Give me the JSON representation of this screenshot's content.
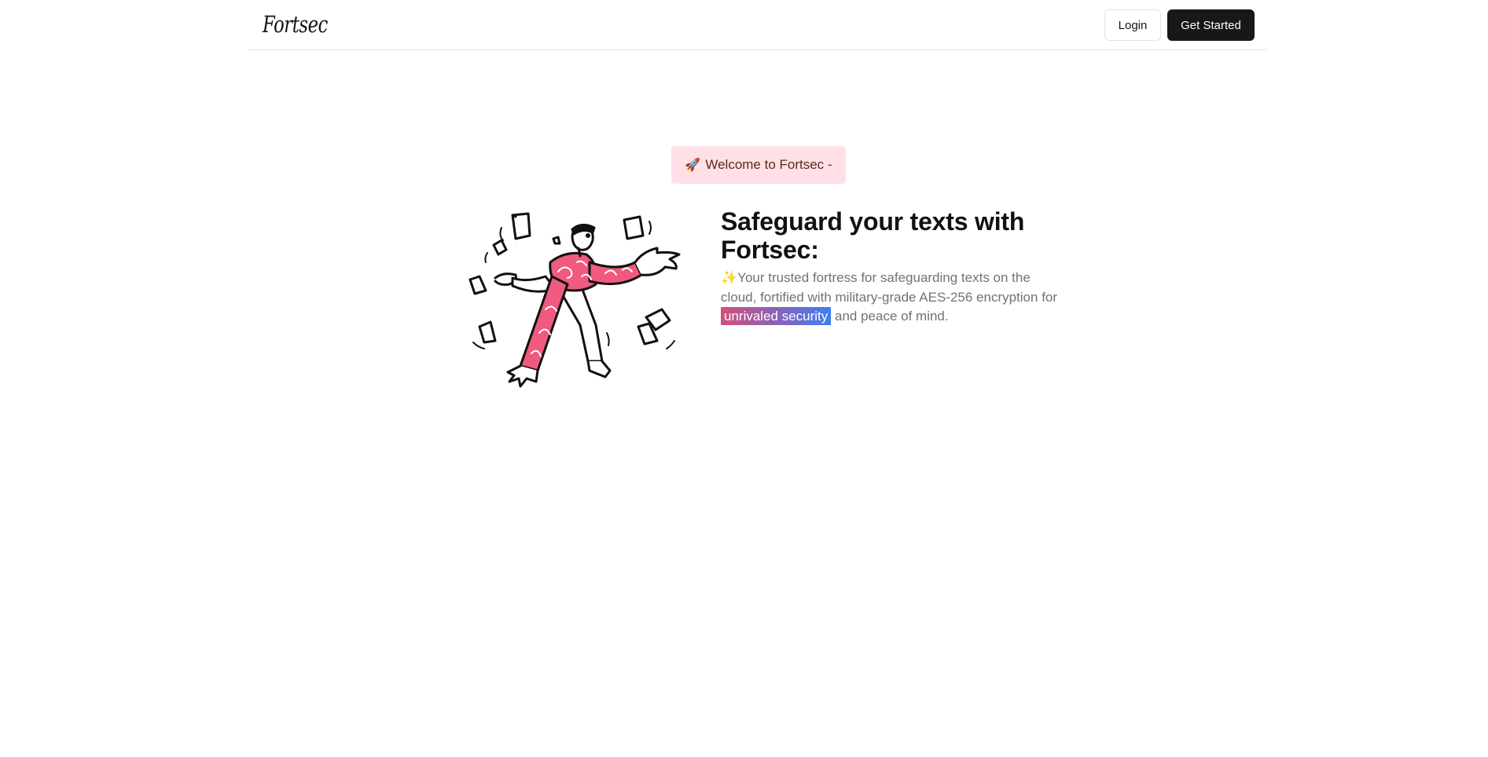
{
  "navbar": {
    "brand": "Fortsec",
    "login_label": "Login",
    "get_started_label": "Get Started"
  },
  "hero": {
    "badge_icon": "🚀",
    "badge_text": "Welcome to Fortsec -",
    "title": "Safeguard your texts with Fortsec:",
    "desc_icon": "✨",
    "desc_before": "Your trusted fortress for safeguarding texts on the cloud, fortified with military-grade AES-256 encryption for ",
    "desc_highlight": "unrivaled security",
    "desc_after": " and peace of mind."
  },
  "colors": {
    "accent_pink": "#f05a7e",
    "badge_bg": "#ffe0e6",
    "primary_button": "#18181b"
  }
}
